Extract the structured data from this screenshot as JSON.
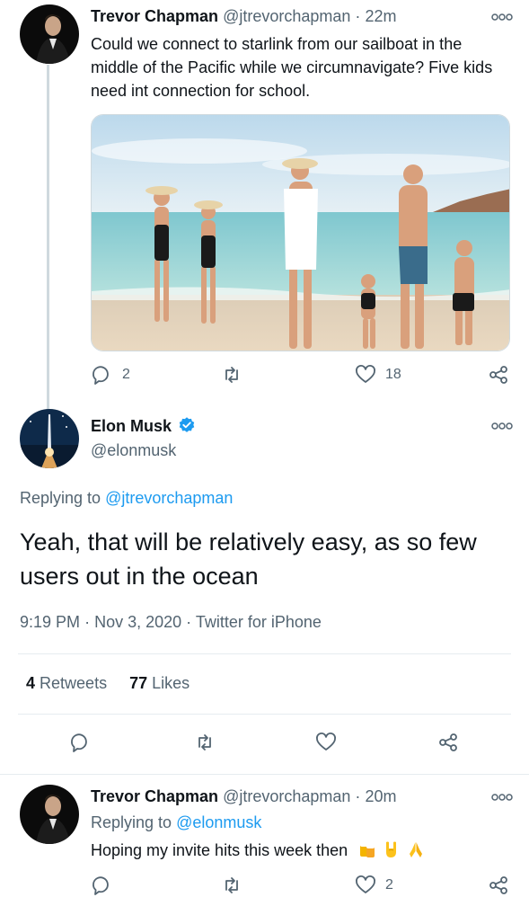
{
  "tweet1": {
    "name": "Trevor Chapman",
    "handle": "@jtrevorchapman",
    "separator": "·",
    "time": "22m",
    "text": "Could we connect to starlink from our sailboat in the middle of the Pacific while we circumnavigate? Five kids need int connection for school.",
    "reply_count": "2",
    "like_count": "18"
  },
  "main": {
    "name": "Elon Musk",
    "handle": "@elonmusk",
    "verified": true,
    "replying_prefix": "Replying to",
    "replying_to": "@jtrevorchapman",
    "text": "Yeah, that will be relatively easy, as so few users out in the ocean",
    "time": "9:19 PM",
    "date": "Nov 3, 2020",
    "source": "Twitter for iPhone",
    "retweets_count": "4",
    "retweets_label": "Retweets",
    "likes_count": "77",
    "likes_label": "Likes"
  },
  "tweet3": {
    "name": "Trevor Chapman",
    "handle": "@jtrevorchapman",
    "separator": "·",
    "time": "20m",
    "replying_prefix": "Replying to",
    "replying_to": "@elonmusk",
    "text": "Hoping my invite hits this week then",
    "like_count": "2"
  },
  "colors": {
    "accent": "#1d9bf0",
    "muted": "#536471",
    "border": "#e6ecf0"
  }
}
